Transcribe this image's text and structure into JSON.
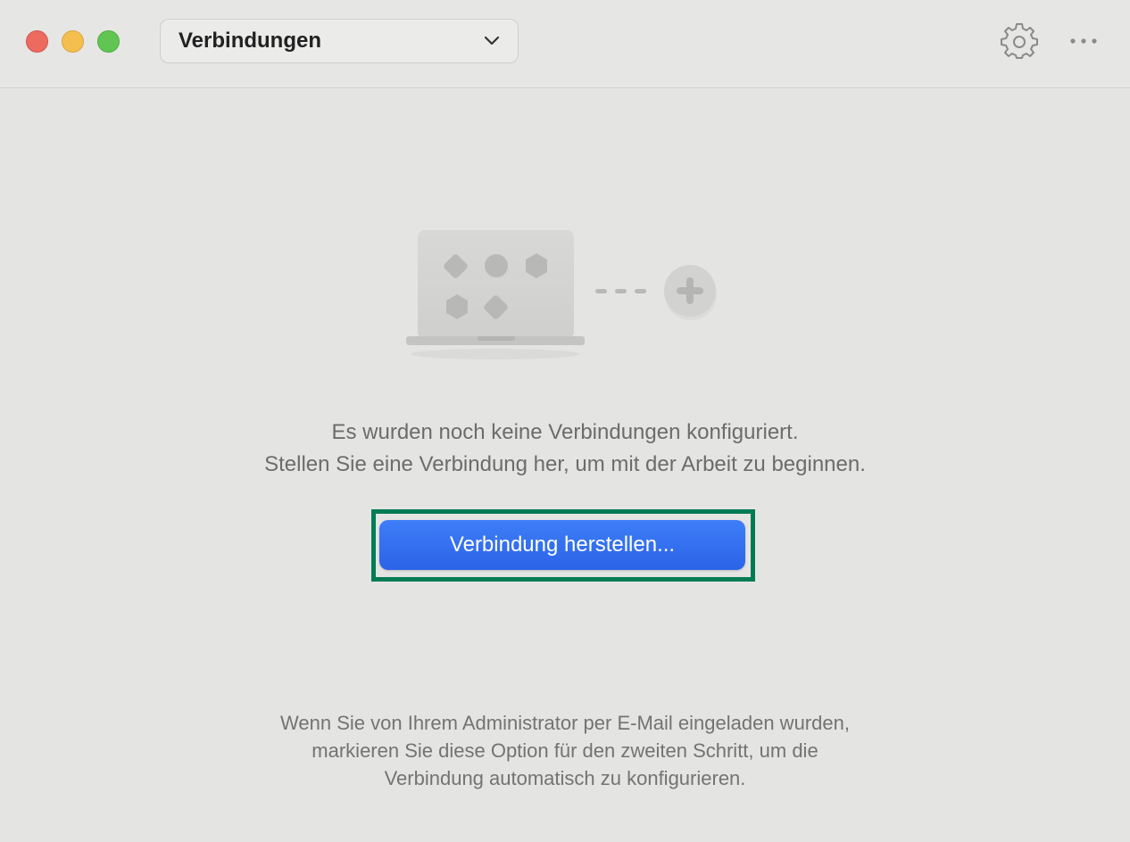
{
  "titlebar": {
    "selector_label": "Verbindungen",
    "icons": {
      "close": "close-window",
      "minimize": "minimize-window",
      "zoom": "zoom-window",
      "settings": "gear-icon",
      "more": "ellipsis-icon",
      "selector": "chevron-down-icon"
    }
  },
  "empty_state": {
    "line1": "Es wurden noch keine Verbindungen konfiguriert.",
    "line2": "Stellen Sie eine Verbindung her, um mit der Arbeit zu beginnen.",
    "button_label": "Verbindung herstellen..."
  },
  "footer": {
    "line1": "Wenn Sie von Ihrem Administrator per E-Mail eingeladen wurden,",
    "line2": "markieren Sie diese Option für den zweiten Schritt, um die",
    "line3": "Verbindung automatisch zu konfigurieren."
  },
  "colors": {
    "background": "#e4e4e3",
    "accent": "#2b63e8",
    "focus_ring": "#007c55",
    "close": "#ec6a5e",
    "minimize": "#f4bf4f",
    "zoom": "#61c554"
  }
}
